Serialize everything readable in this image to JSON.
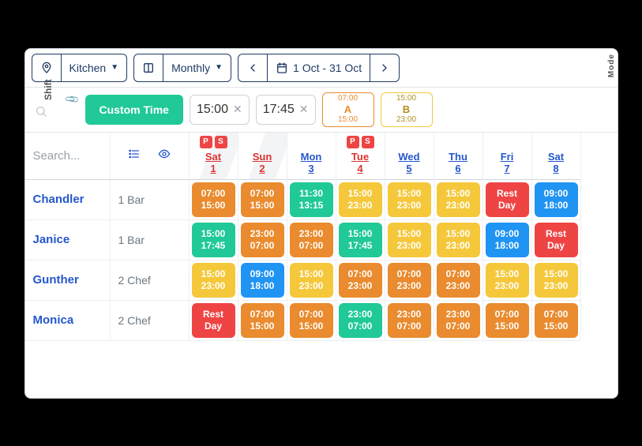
{
  "toolbar": {
    "location_label": "Kitchen",
    "view_label": "Monthly",
    "date_range": "1 Oct - 31 Oct",
    "mode_label": "Mode"
  },
  "custom_time": {
    "button_label": "Custom Time",
    "shift_label": "Shift",
    "start": "15:00",
    "end": "17:45"
  },
  "presets": [
    {
      "top": "07:00",
      "label": "A",
      "bottom": "15:00",
      "color": "orange"
    },
    {
      "top": "15:00",
      "label": "B",
      "bottom": "23:00",
      "color": "yellow"
    }
  ],
  "search_placeholder": "Search...",
  "badge_letters": {
    "p": "P",
    "s": "S"
  },
  "headers": [
    {
      "day": "Sat",
      "num": "1",
      "holiday": true,
      "badges": true
    },
    {
      "day": "Sun",
      "num": "2",
      "holiday": true,
      "badges": false
    },
    {
      "day": "Mon",
      "num": "3",
      "holiday": false,
      "badges": false
    },
    {
      "day": "Tue",
      "num": "4",
      "holiday": true,
      "badges": true
    },
    {
      "day": "Wed",
      "num": "5",
      "holiday": false,
      "badges": false
    },
    {
      "day": "Thu",
      "num": "6",
      "holiday": false,
      "badges": false
    },
    {
      "day": "Fri",
      "num": "7",
      "holiday": false,
      "badges": false
    },
    {
      "day": "Sat",
      "num": "8",
      "holiday": false,
      "badges": false
    }
  ],
  "rows": [
    {
      "name": "Chandler",
      "role": "1 Bar",
      "cells": [
        {
          "t1": "07:00",
          "t2": "15:00",
          "c": "orange-bg"
        },
        {
          "t1": "07:00",
          "t2": "15:00",
          "c": "orange-bg"
        },
        {
          "t1": "11:30",
          "t2": "13:15",
          "c": "teal-bg"
        },
        {
          "t1": "15:00",
          "t2": "23:00",
          "c": "yellow-bg"
        },
        {
          "t1": "15:00",
          "t2": "23:00",
          "c": "yellow-bg"
        },
        {
          "t1": "15:00",
          "t2": "23:00",
          "c": "yellow-bg"
        },
        {
          "rest": "Rest Day",
          "c": "red-bg"
        },
        {
          "t1": "09:00",
          "t2": "18:00",
          "c": "blue-bg"
        }
      ]
    },
    {
      "name": "Janice",
      "role": "1 Bar",
      "cells": [
        {
          "t1": "15:00",
          "t2": "17:45",
          "c": "teal-bg"
        },
        {
          "t1": "23:00",
          "t2": "07:00",
          "c": "orange-bg"
        },
        {
          "t1": "23:00",
          "t2": "07:00",
          "c": "orange-bg"
        },
        {
          "t1": "15:00",
          "t2": "17:45",
          "c": "teal-bg"
        },
        {
          "t1": "15:00",
          "t2": "23:00",
          "c": "yellow-bg"
        },
        {
          "t1": "15:00",
          "t2": "23:00",
          "c": "yellow-bg"
        },
        {
          "t1": "09:00",
          "t2": "18:00",
          "c": "blue-bg"
        },
        {
          "rest": "Rest Day",
          "c": "red-bg"
        }
      ]
    },
    {
      "name": "Gunther",
      "role": "2 Chef",
      "cells": [
        {
          "t1": "15:00",
          "t2": "23:00",
          "c": "yellow-bg"
        },
        {
          "t1": "09:00",
          "t2": "18:00",
          "c": "blue-bg"
        },
        {
          "t1": "15:00",
          "t2": "23:00",
          "c": "yellow-bg"
        },
        {
          "t1": "07:00",
          "t2": "23:00",
          "c": "orange-bg"
        },
        {
          "t1": "07:00",
          "t2": "23:00",
          "c": "orange-bg"
        },
        {
          "t1": "07:00",
          "t2": "23:00",
          "c": "orange-bg"
        },
        {
          "t1": "15:00",
          "t2": "23:00",
          "c": "yellow-bg"
        },
        {
          "t1": "15:00",
          "t2": "23:00",
          "c": "yellow-bg"
        }
      ]
    },
    {
      "name": "Monica",
      "role": "2 Chef",
      "cells": [
        {
          "rest": "Rest Day",
          "c": "red-bg"
        },
        {
          "t1": "07:00",
          "t2": "15:00",
          "c": "orange-bg"
        },
        {
          "t1": "07:00",
          "t2": "15:00",
          "c": "orange-bg"
        },
        {
          "t1": "23:00",
          "t2": "07:00",
          "c": "teal-bg"
        },
        {
          "t1": "23:00",
          "t2": "07:00",
          "c": "orange-bg"
        },
        {
          "t1": "23:00",
          "t2": "07:00",
          "c": "orange-bg"
        },
        {
          "t1": "07:00",
          "t2": "15:00",
          "c": "orange-bg"
        },
        {
          "t1": "07:00",
          "t2": "15:00",
          "c": "orange-bg"
        }
      ]
    }
  ]
}
